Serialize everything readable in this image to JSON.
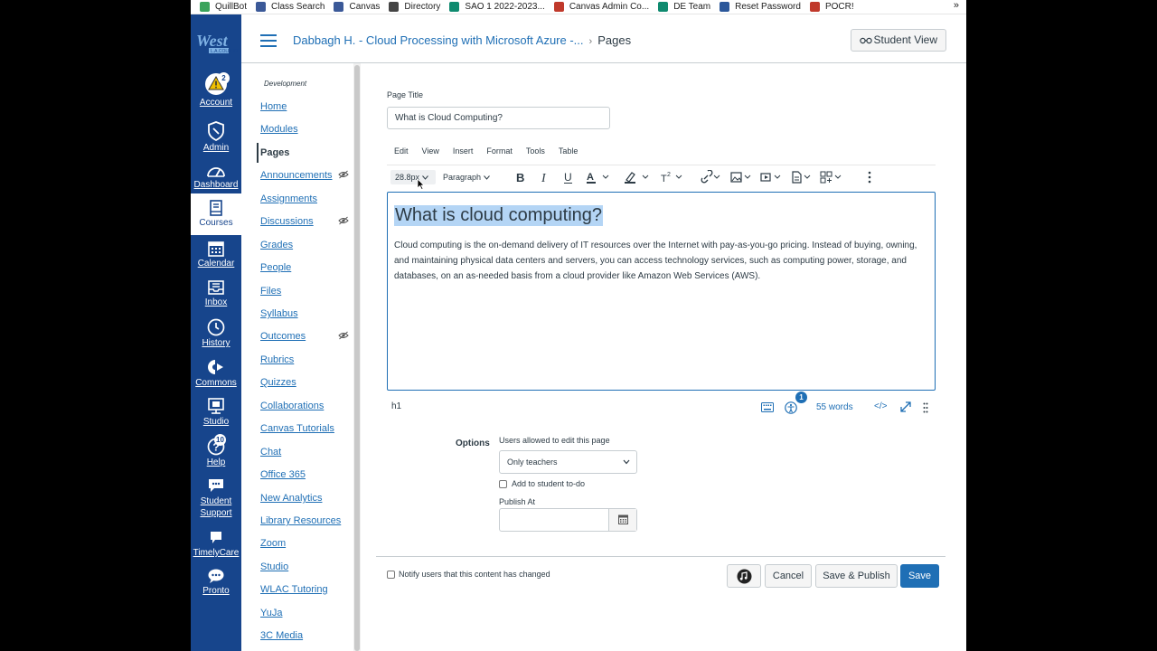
{
  "bookmarks": [
    {
      "label": "QuillBot",
      "color": "#3aa35b"
    },
    {
      "label": "Class Search",
      "color": "#3b5998"
    },
    {
      "label": "Canvas",
      "color": "#3b5998"
    },
    {
      "label": "Directory",
      "color": "#444444"
    },
    {
      "label": "SAO 1 2022-2023...",
      "color": "#0f8a6f"
    },
    {
      "label": "Canvas Admin Co...",
      "color": "#c0392b"
    },
    {
      "label": "DE Team",
      "color": "#0f8a6f"
    },
    {
      "label": "Reset Password",
      "color": "#2b579a"
    },
    {
      "label": "POCR!",
      "color": "#c0392b"
    }
  ],
  "bookmarks_more": "»",
  "global_nav": {
    "account": {
      "label": "Account",
      "badge": "2",
      "icon": "warning-icon"
    },
    "admin": {
      "label": "Admin",
      "icon": "shield-icon"
    },
    "dashboard": {
      "label": "Dashboard",
      "icon": "dashboard-icon"
    },
    "courses": {
      "label": "Courses",
      "icon": "book-icon"
    },
    "calendar": {
      "label": "Calendar",
      "icon": "calendar-icon"
    },
    "inbox": {
      "label": "Inbox",
      "icon": "inbox-icon"
    },
    "history": {
      "label": "History",
      "icon": "clock-icon"
    },
    "commons": {
      "label": "Commons",
      "icon": "commons-icon"
    },
    "studio": {
      "label": "Studio",
      "icon": "studio-icon"
    },
    "help": {
      "label": "Help",
      "badge": "10",
      "icon": "help-icon"
    },
    "student_support": {
      "label_line1": "Student",
      "label_line2": "Support",
      "icon": "chat-icon"
    },
    "timelycare": {
      "label": "TimelyCare",
      "icon": "flag-icon"
    },
    "pronto": {
      "label": "Pronto",
      "icon": "speech-icon"
    }
  },
  "header": {
    "course_link": "Dabbagh H. - Cloud Processing with Microsoft Azure -...",
    "separator": "›",
    "current": "Pages",
    "student_view": "Student View"
  },
  "course_nav": {
    "subtitle": "Development",
    "items": [
      {
        "label": "Home"
      },
      {
        "label": "Modules"
      },
      {
        "label": "Pages"
      },
      {
        "label": "Announcements"
      },
      {
        "label": "Assignments"
      },
      {
        "label": "Discussions"
      },
      {
        "label": "Grades"
      },
      {
        "label": "People"
      },
      {
        "label": "Files"
      },
      {
        "label": "Syllabus"
      },
      {
        "label": "Outcomes"
      },
      {
        "label": "Rubrics"
      },
      {
        "label": "Quizzes"
      },
      {
        "label": "Collaborations"
      },
      {
        "label": "Canvas Tutorials"
      },
      {
        "label": "Chat"
      },
      {
        "label": "Office 365"
      },
      {
        "label": "New Analytics"
      },
      {
        "label": "Library Resources"
      },
      {
        "label": "Zoom"
      },
      {
        "label": "Studio"
      },
      {
        "label": "WLAC Tutoring"
      },
      {
        "label": "YuJa"
      },
      {
        "label": "3C Media"
      }
    ]
  },
  "editor": {
    "page_title_label": "Page Title",
    "page_title_value": "What is Cloud Computing?",
    "menu": [
      "Edit",
      "View",
      "Insert",
      "Format",
      "Tools",
      "Table"
    ],
    "font_size": "28.8px",
    "block_format": "Paragraph",
    "heading": "What is cloud computing?",
    "body": "Cloud computing is the on-demand delivery of IT resources over the Internet with pay-as-you-go pricing. Instead of buying, owning, and maintaining physical data centers and servers, you can access technology services, such as computing power, storage, and databases, on an as-needed basis from a cloud provider like Amazon Web Services (AWS).",
    "element_path": "h1",
    "a11y_badge": "1",
    "word_count": "55 words",
    "html_toggle": "</>"
  },
  "options": {
    "label": "Options",
    "users_label": "Users allowed to edit this page",
    "users_value": "Only teachers",
    "todo_label": "Add to student to-do",
    "publish_at_label": "Publish At",
    "publish_at_value": ""
  },
  "footer": {
    "notify_label": "Notify users that this content has changed",
    "cancel": "Cancel",
    "save_publish": "Save & Publish",
    "save": "Save"
  },
  "colors": {
    "nav_bg": "#17458c",
    "link": "#1f6fb5",
    "text": "#2d3b45",
    "highlight": "#b4d5f5"
  }
}
